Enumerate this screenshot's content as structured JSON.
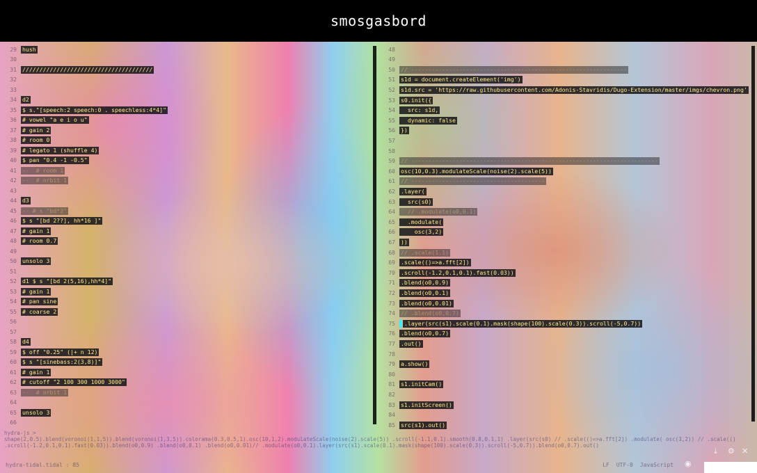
{
  "window": {
    "title": "smosgasbord"
  },
  "left_pane": {
    "lines": [
      {
        "n": "29",
        "code": "hush",
        "style": "hl"
      },
      {
        "n": "30",
        "code": "",
        "style": "hl"
      },
      {
        "n": "31",
        "code": "//////////////////////////////////////",
        "style": "hl"
      },
      {
        "n": "32",
        "code": "",
        "style": "hl"
      },
      {
        "n": "33",
        "code": "",
        "style": "hl"
      },
      {
        "n": "34",
        "code": "d2",
        "style": "hl"
      },
      {
        "n": "35",
        "code": "$ s.\"[speech:2 speech:0 . speechless:4*4]\"",
        "style": "hl"
      },
      {
        "n": "36",
        "code": "# vowel \"a e i o u\"",
        "style": "hl"
      },
      {
        "n": "37",
        "code": "# gain 2",
        "style": "hl"
      },
      {
        "n": "38",
        "code": "# room 0",
        "style": "hl"
      },
      {
        "n": "39",
        "code": "# legato 1 (shuffle 4)",
        "style": "hl"
      },
      {
        "n": "40",
        "code": "$ pan \"0.4 -1 -0.5\"",
        "style": "hl"
      },
      {
        "n": "41",
        "code": "--  # room 1",
        "style": "dim"
      },
      {
        "n": "42",
        "code": "--  # orbit 1",
        "style": "dim"
      },
      {
        "n": "43",
        "code": "",
        "style": "hl"
      },
      {
        "n": "44",
        "code": "d3",
        "style": "hl"
      },
      {
        "n": "45",
        "code": "-- # s \"bd*2\"",
        "style": "dim"
      },
      {
        "n": "46",
        "code": "$ s \"[bd 2??], hh*16 ]\"",
        "style": "hl"
      },
      {
        "n": "47",
        "code": "# gain 1",
        "style": "hl"
      },
      {
        "n": "48",
        "code": "# room 0.7",
        "style": "hl"
      },
      {
        "n": "49",
        "code": "",
        "style": "hl"
      },
      {
        "n": "50",
        "code": "unsolo 3",
        "style": "hl"
      },
      {
        "n": "51",
        "code": "",
        "style": "hl"
      },
      {
        "n": "52",
        "code": "d1 $ s \"[bd 2(5,16),hh*4]\"",
        "style": "hl"
      },
      {
        "n": "53",
        "code": "# gain 1",
        "style": "hl"
      },
      {
        "n": "54",
        "code": "# pan sine",
        "style": "hl"
      },
      {
        "n": "55",
        "code": "# coarse 2",
        "style": "hl"
      },
      {
        "n": "56",
        "code": "",
        "style": "hl"
      },
      {
        "n": "57",
        "code": "",
        "style": "hl"
      },
      {
        "n": "58",
        "code": "d4",
        "style": "hl"
      },
      {
        "n": "59",
        "code": "$ off \"0.25\" (|+ n 12)",
        "style": "hl"
      },
      {
        "n": "60",
        "code": "$ s \"[sinebass:2(3,8)]\"",
        "style": "hl"
      },
      {
        "n": "61",
        "code": "# gain 1",
        "style": "hl"
      },
      {
        "n": "62",
        "code": "# cutoff \"2 100 300 1000 3000\"",
        "style": "hl"
      },
      {
        "n": "63",
        "code": "--  # orbit 1",
        "style": "dim"
      },
      {
        "n": "64",
        "code": "",
        "style": "hl"
      },
      {
        "n": "65",
        "code": "unsolo 3",
        "style": "hl"
      },
      {
        "n": "66",
        "code": "",
        "style": "hl"
      }
    ]
  },
  "right_pane": {
    "lines": [
      {
        "n": "48",
        "code": "",
        "style": "hl"
      },
      {
        "n": "49",
        "code": "",
        "style": "hl"
      },
      {
        "n": "50",
        "code": "// ---------------------------------------------------------------",
        "style": "dim"
      },
      {
        "n": "51",
        "code": "s1d = document.createElement('img')",
        "style": "hl"
      },
      {
        "n": "52",
        "code": "s1d.src = 'https://raw.githubusercontent.com/Adonis-Stavridis/Dugo-Extension/master/imgs/chevron.png'",
        "style": "hl"
      },
      {
        "n": "53",
        "code": "s0.init({",
        "style": "hl"
      },
      {
        "n": "54",
        "code": "  src: s1d,",
        "style": "hl"
      },
      {
        "n": "55",
        "code": "  dynamic: false",
        "style": "hl"
      },
      {
        "n": "56",
        "code": "})",
        "style": "hl"
      },
      {
        "n": "57",
        "code": "",
        "style": "hl"
      },
      {
        "n": "58",
        "code": "",
        "style": "hl"
      },
      {
        "n": "59",
        "code": "// ------------------------------------------------------------------------",
        "style": "dim"
      },
      {
        "n": "60",
        "code": "osc(10,0.3).modulateScale(noise(2).scale(5))",
        "style": "hl"
      },
      {
        "n": "61",
        "code": "// ---------------------------------------",
        "style": "dim"
      },
      {
        "n": "62",
        "code": ".layer(",
        "style": "hl"
      },
      {
        "n": "63",
        "code": "  src(s0)",
        "style": "hl"
      },
      {
        "n": "64",
        "code": "  // .modulate(o0,0.1)",
        "style": "dim"
      },
      {
        "n": "65",
        "code": "  .modulate(",
        "style": "hl"
      },
      {
        "n": "66",
        "code": "    osc(3,2)",
        "style": "hl"
      },
      {
        "n": "67",
        "code": "))",
        "style": "hl"
      },
      {
        "n": "68",
        "code": "// .scale(1.1)",
        "style": "dim"
      },
      {
        "n": "69",
        "code": ".scale(()=>a.fft[2])",
        "style": "hl"
      },
      {
        "n": "70",
        "code": ".scroll(-1.2,0.1,0.1).fast(0.03))",
        "style": "hl"
      },
      {
        "n": "71",
        "code": ".blend(o0,0.9)",
        "style": "hl"
      },
      {
        "n": "72",
        "code": ".blend(o0,0.1)",
        "style": "hl"
      },
      {
        "n": "73",
        "code": ".blend(o0,0.01)",
        "style": "hl"
      },
      {
        "n": "74",
        "code": "// .blend(o0,0.7)",
        "style": "dim"
      },
      {
        "n": "75",
        "code": ".layer(src(s1).scale(0.1).mask(shape(100).scale(0.3)).scroll(-5,0.7))",
        "style": "hl",
        "cursor": true
      },
      {
        "n": "76",
        "code": ".blend(o0,0.7)",
        "style": "hl"
      },
      {
        "n": "77",
        "code": ".out()",
        "style": "hl"
      },
      {
        "n": "78",
        "code": "",
        "style": "hl"
      },
      {
        "n": "79",
        "code": "a.show()",
        "style": "hl"
      },
      {
        "n": "80",
        "code": "",
        "style": "hl"
      },
      {
        "n": "81",
        "code": "s1.initCam()",
        "style": "hl"
      },
      {
        "n": "82",
        "code": "",
        "style": "hl"
      },
      {
        "n": "83",
        "code": "s1.initScreen()",
        "style": "hl"
      },
      {
        "n": "84",
        "code": "",
        "style": "hl"
      },
      {
        "n": "85",
        "code": "src(s1).out()",
        "style": "hl"
      }
    ]
  },
  "console": {
    "line1": "hydra-js >",
    "line2": "shape(2,0.5).blend(voronoi(1,1,5)).blend(voronoi(1,3,5)).colorama(0.3,0.5,1).osc(10,1,2).modulateScale(noise(2).scale(5)) .scroll(-1.1,0.1).smooth(0.8,0.1,1) .layer(src(s0) // .scale(()=>a.fft[2]) .modulate( osc(3,2)) // .scale(()=>a.fft[2])",
    "line3": ".scroll(-1.2,0.1,0.1).fast(0.03)).blend(o0,0.9) .blend(o0,0.1) .blend(o0,0.01)// .modulate(o0,0.1).layer(src(s1).scale(0.1).mask(shape(100).scale(0.3)).scroll(-5,0.7)).blend(o0,0.7).out()"
  },
  "statusbar": {
    "left": "hydra-tidal.tidal  :  85",
    "lf": "LF",
    "encoding": "UTF-8",
    "language": "JavaScript"
  }
}
